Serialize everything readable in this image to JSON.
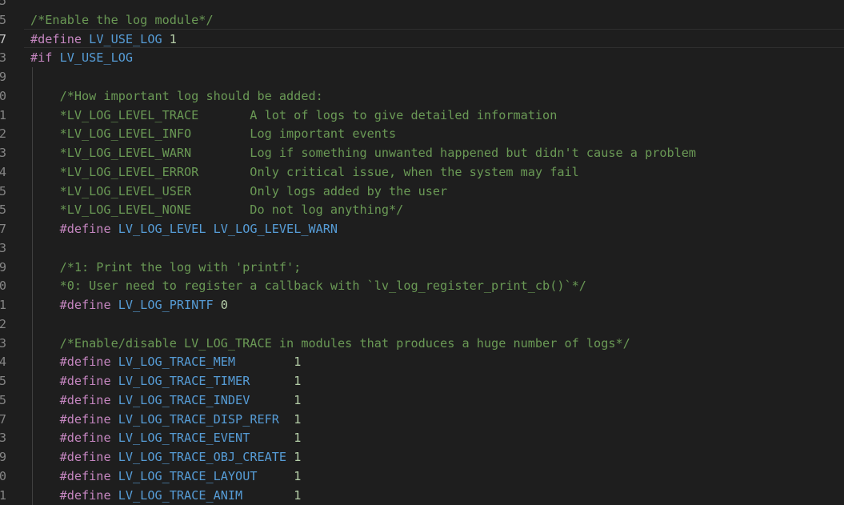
{
  "editor": {
    "lines": [
      {
        "num": "5",
        "segments": []
      },
      {
        "num": "5",
        "segments": [
          {
            "t": "comment",
            "s": "/*Enable the log module*/"
          }
        ]
      },
      {
        "num": "7",
        "active": true,
        "segments": [
          {
            "t": "directive",
            "s": "#define"
          },
          {
            "t": "ws",
            "s": " "
          },
          {
            "t": "macro",
            "s": "LV_USE_LOG"
          },
          {
            "t": "ws",
            "s": " "
          },
          {
            "t": "num",
            "s": "1"
          }
        ]
      },
      {
        "num": "3",
        "segments": [
          {
            "t": "directive",
            "s": "#if"
          },
          {
            "t": "ws",
            "s": " "
          },
          {
            "t": "macro",
            "s": "LV_USE_LOG"
          }
        ]
      },
      {
        "num": "9",
        "segments": []
      },
      {
        "num": "0",
        "segments": [
          {
            "t": "comment",
            "s": "    /*How important log should be added:"
          }
        ]
      },
      {
        "num": "1",
        "segments": [
          {
            "t": "comment",
            "s": "    *LV_LOG_LEVEL_TRACE       A lot of logs to give detailed information"
          }
        ]
      },
      {
        "num": "2",
        "segments": [
          {
            "t": "comment",
            "s": "    *LV_LOG_LEVEL_INFO        Log important events"
          }
        ]
      },
      {
        "num": "3",
        "segments": [
          {
            "t": "comment",
            "s": "    *LV_LOG_LEVEL_WARN        Log if something unwanted happened but didn't cause a problem"
          }
        ]
      },
      {
        "num": "4",
        "segments": [
          {
            "t": "comment",
            "s": "    *LV_LOG_LEVEL_ERROR       Only critical issue, when the system may fail"
          }
        ]
      },
      {
        "num": "5",
        "segments": [
          {
            "t": "comment",
            "s": "    *LV_LOG_LEVEL_USER        Only logs added by the user"
          }
        ]
      },
      {
        "num": "5",
        "segments": [
          {
            "t": "comment",
            "s": "    *LV_LOG_LEVEL_NONE        Do not log anything*/"
          }
        ]
      },
      {
        "num": "7",
        "segments": [
          {
            "t": "ws",
            "s": "    "
          },
          {
            "t": "directive",
            "s": "#define"
          },
          {
            "t": "ws",
            "s": " "
          },
          {
            "t": "macro",
            "s": "LV_LOG_LEVEL LV_LOG_LEVEL_WARN"
          }
        ]
      },
      {
        "num": "3",
        "segments": []
      },
      {
        "num": "9",
        "segments": [
          {
            "t": "comment",
            "s": "    /*1: Print the log with 'printf';"
          }
        ]
      },
      {
        "num": "0",
        "segments": [
          {
            "t": "comment",
            "s": "    *0: User need to register a callback with `lv_log_register_print_cb()`*/"
          }
        ]
      },
      {
        "num": "1",
        "segments": [
          {
            "t": "ws",
            "s": "    "
          },
          {
            "t": "directive",
            "s": "#define"
          },
          {
            "t": "ws",
            "s": " "
          },
          {
            "t": "macro",
            "s": "LV_LOG_PRINTF"
          },
          {
            "t": "ws",
            "s": " "
          },
          {
            "t": "num",
            "s": "0"
          }
        ]
      },
      {
        "num": "2",
        "segments": []
      },
      {
        "num": "3",
        "segments": [
          {
            "t": "comment",
            "s": "    /*Enable/disable LV_LOG_TRACE in modules that produces a huge number of logs*/"
          }
        ]
      },
      {
        "num": "4",
        "segments": [
          {
            "t": "ws",
            "s": "    "
          },
          {
            "t": "directive",
            "s": "#define"
          },
          {
            "t": "ws",
            "s": " "
          },
          {
            "t": "macro",
            "s": "LV_LOG_TRACE_MEM"
          },
          {
            "t": "ws",
            "s": "        "
          },
          {
            "t": "num",
            "s": "1"
          }
        ]
      },
      {
        "num": "5",
        "segments": [
          {
            "t": "ws",
            "s": "    "
          },
          {
            "t": "directive",
            "s": "#define"
          },
          {
            "t": "ws",
            "s": " "
          },
          {
            "t": "macro",
            "s": "LV_LOG_TRACE_TIMER"
          },
          {
            "t": "ws",
            "s": "      "
          },
          {
            "t": "num",
            "s": "1"
          }
        ]
      },
      {
        "num": "5",
        "segments": [
          {
            "t": "ws",
            "s": "    "
          },
          {
            "t": "directive",
            "s": "#define"
          },
          {
            "t": "ws",
            "s": " "
          },
          {
            "t": "macro",
            "s": "LV_LOG_TRACE_INDEV"
          },
          {
            "t": "ws",
            "s": "      "
          },
          {
            "t": "num",
            "s": "1"
          }
        ]
      },
      {
        "num": "7",
        "segments": [
          {
            "t": "ws",
            "s": "    "
          },
          {
            "t": "directive",
            "s": "#define"
          },
          {
            "t": "ws",
            "s": " "
          },
          {
            "t": "macro",
            "s": "LV_LOG_TRACE_DISP_REFR"
          },
          {
            "t": "ws",
            "s": "  "
          },
          {
            "t": "num",
            "s": "1"
          }
        ]
      },
      {
        "num": "3",
        "segments": [
          {
            "t": "ws",
            "s": "    "
          },
          {
            "t": "directive",
            "s": "#define"
          },
          {
            "t": "ws",
            "s": " "
          },
          {
            "t": "macro",
            "s": "LV_LOG_TRACE_EVENT"
          },
          {
            "t": "ws",
            "s": "      "
          },
          {
            "t": "num",
            "s": "1"
          }
        ]
      },
      {
        "num": "9",
        "segments": [
          {
            "t": "ws",
            "s": "    "
          },
          {
            "t": "directive",
            "s": "#define"
          },
          {
            "t": "ws",
            "s": " "
          },
          {
            "t": "macro",
            "s": "LV_LOG_TRACE_OBJ_CREATE"
          },
          {
            "t": "ws",
            "s": " "
          },
          {
            "t": "num",
            "s": "1"
          }
        ]
      },
      {
        "num": "0",
        "segments": [
          {
            "t": "ws",
            "s": "    "
          },
          {
            "t": "directive",
            "s": "#define"
          },
          {
            "t": "ws",
            "s": " "
          },
          {
            "t": "macro",
            "s": "LV_LOG_TRACE_LAYOUT"
          },
          {
            "t": "ws",
            "s": "     "
          },
          {
            "t": "num",
            "s": "1"
          }
        ]
      },
      {
        "num": "1",
        "segments": [
          {
            "t": "ws",
            "s": "    "
          },
          {
            "t": "directive",
            "s": "#define"
          },
          {
            "t": "ws",
            "s": " "
          },
          {
            "t": "macro",
            "s": "LV_LOG_TRACE_ANIM"
          },
          {
            "t": "ws",
            "s": "       "
          },
          {
            "t": "num",
            "s": "1"
          }
        ]
      }
    ]
  },
  "colors": {
    "background": "#1e1e1e",
    "comment": "#6a9955",
    "directive": "#c586c0",
    "macro": "#569cd6",
    "number": "#b5cea8",
    "line_number": "#858585"
  }
}
